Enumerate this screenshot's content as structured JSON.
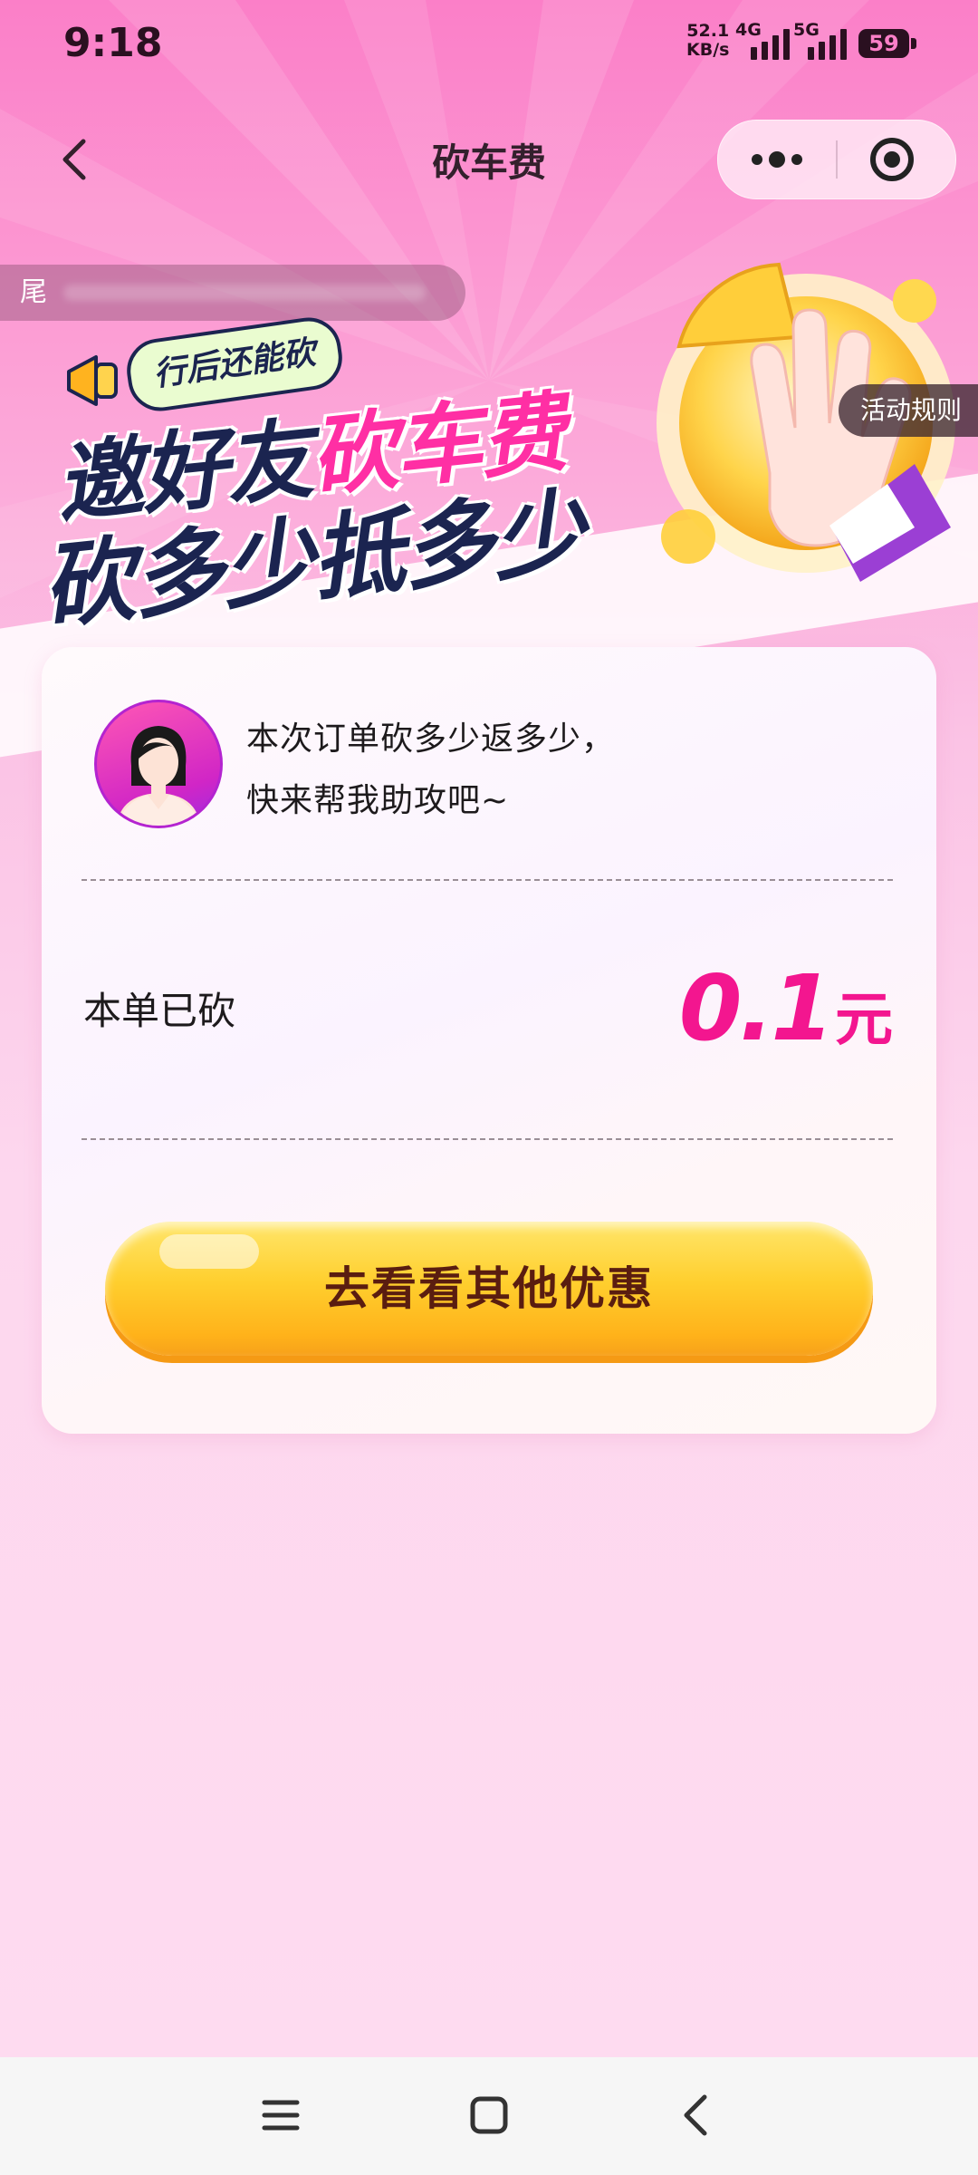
{
  "status_bar": {
    "time": "9:18",
    "net_speed_value": "52.1",
    "net_speed_unit": "KB/s",
    "sim1_label": "4G",
    "sim2_label": "5G",
    "battery": "59"
  },
  "nav": {
    "title": "砍车费"
  },
  "marquee": {
    "text": "尾"
  },
  "banner": {
    "tag": "行后还能砍",
    "line1_prefix": "邀好友",
    "line1_highlight": "砍车费",
    "line2": "砍多少抵多少",
    "rules_button": "活动规则"
  },
  "card": {
    "message_line1": "本次订单砍多少返多少，",
    "message_line2": "快来帮我助攻吧~",
    "cut_label": "本单已砍",
    "cut_amount": "0.1",
    "cut_unit": "元",
    "cta_label": "去看看其他优惠"
  },
  "colors": {
    "accent_pink": "#f3168f",
    "cta_yellow": "#ffcf2e",
    "banner_navy": "#1b2450"
  },
  "icons": {
    "back": "chevron-left-icon",
    "more": "more-dots-icon",
    "close": "target-circle-icon",
    "system_menu": "menu-lines-icon",
    "system_home": "square-icon",
    "system_back": "chevron-left-icon"
  }
}
